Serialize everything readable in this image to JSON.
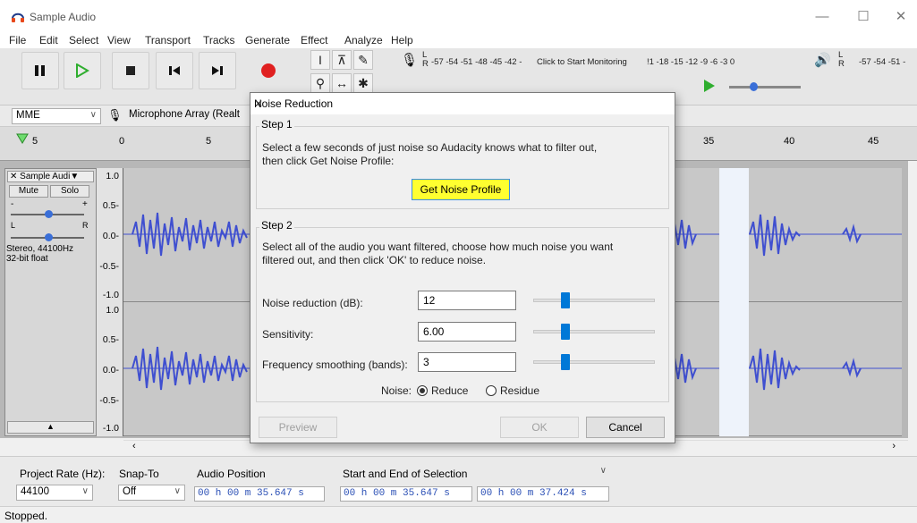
{
  "window": {
    "title": "Sample Audio",
    "minimize": "—",
    "maximize": "☐",
    "close": "✕"
  },
  "menu": [
    "File",
    "Edit",
    "Select",
    "View",
    "Transport",
    "Tracks",
    "Generate",
    "Effect",
    "Analyze",
    "Help"
  ],
  "meters": {
    "record_label_l": "L",
    "record_label_r": "R",
    "record_scale": "-57 -54 -51 -48 -45 -42 -",
    "record_monitor": "Click to Start Monitoring",
    "record_scale2": "!1 -18 -15 -12  -9  -6  -3  0",
    "play_label_l": "L",
    "play_label_r": "R",
    "play_scale": "-57 -54 -51 -"
  },
  "devices": {
    "host": "MME",
    "input": "Microphone Array (Realt"
  },
  "ruler": {
    "ticks": [
      "5",
      "0",
      "5",
      "35",
      "40",
      "45"
    ]
  },
  "track": {
    "name": "Sample Audi",
    "mute": "Mute",
    "solo": "Solo",
    "gain_minus": "-",
    "gain_plus": "+",
    "pan_l": "L",
    "pan_r": "R",
    "info1": "Stereo, 44100Hz",
    "info2": "32-bit float",
    "collapse": "▲",
    "scale": [
      "1.0",
      "0.5-",
      "0.0-",
      "-0.5-",
      "-1.0",
      "1.0",
      "0.5-",
      "0.0-",
      "-0.5-",
      "-1.0"
    ]
  },
  "selection_bar": {
    "project_rate_label": "Project Rate (Hz):",
    "project_rate": "44100",
    "snap_label": "Snap-To",
    "snap_value": "Off",
    "audio_position_label": "Audio Position",
    "audio_position": "00 h 00 m 35.647 s",
    "selection_label": "Start and End of Selection",
    "sel_start": "00 h 00 m 35.647 s",
    "sel_end": "00 h 00 m 37.424 s"
  },
  "status": "Stopped.",
  "dialog": {
    "title": "Noise Reduction",
    "step1_title": "Step 1",
    "step1_text1": "Select a few seconds of just noise so Audacity knows what to filter out,",
    "step1_text2": "then click Get Noise Profile:",
    "get_profile": "Get Noise Profile",
    "step2_title": "Step 2",
    "step2_text1": "Select all of the audio you want filtered, choose how much noise you want",
    "step2_text2": "filtered out, and then click 'OK' to reduce noise.",
    "noise_reduction_label": "Noise reduction (dB):",
    "noise_reduction_value": "12",
    "sensitivity_label": "Sensitivity:",
    "sensitivity_value": "6.00",
    "smoothing_label": "Frequency smoothing (bands):",
    "smoothing_value": "3",
    "noise_label": "Noise:",
    "reduce_label": "Reduce",
    "residue_label": "Residue",
    "preview": "Preview",
    "ok": "OK",
    "cancel": "Cancel"
  },
  "colors": {
    "accent": "#0078d7",
    "waveform": "#3f4fd0",
    "highlight": "#ffff30"
  }
}
